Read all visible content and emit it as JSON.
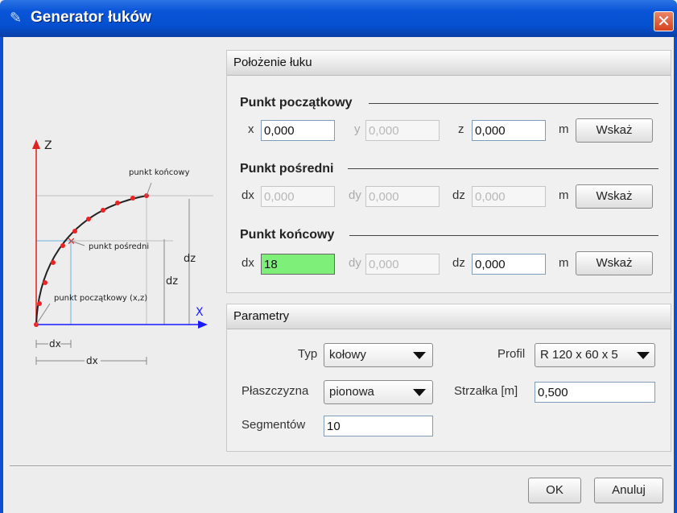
{
  "window": {
    "title": "Generator łuków"
  },
  "diagram": {
    "axis_z": "Z",
    "axis_x": "X",
    "label_end": "punkt końcowy",
    "label_mid": "punkt pośredni",
    "label_start": "punkt początkowy (x,z)",
    "label_dz1": "dz",
    "label_dz2": "dz",
    "label_dx1": "dx",
    "label_dx2": "dx",
    "colors": {
      "axis": "#1a1aff",
      "zaxis": "#dd2222",
      "curve": "#222222",
      "points": "#ee2222",
      "guide": "#6fb3e0"
    }
  },
  "position_group": {
    "header": "Położenie łuku",
    "start": {
      "title": "Punkt początkowy",
      "x_label": "x",
      "x_value": "0,000",
      "y_label": "y",
      "y_value": "0,000",
      "z_label": "z",
      "z_value": "0,000",
      "unit": "m",
      "button": "Wskaż"
    },
    "mid": {
      "title": "Punkt pośredni",
      "dx_label": "dx",
      "dx_value": "0,000",
      "dy_label": "dy",
      "dy_value": "0,000",
      "dz_label": "dz",
      "dz_value": "0,000",
      "unit": "m",
      "button": "Wskaż"
    },
    "end": {
      "title": "Punkt końcowy",
      "dx_label": "dx",
      "dx_value": "18",
      "dy_label": "dy",
      "dy_value": "0,000",
      "dz_label": "dz",
      "dz_value": "0,000",
      "unit": "m",
      "button": "Wskaż"
    }
  },
  "params_group": {
    "header": "Parametry",
    "typ_label": "Typ",
    "typ_value": "kołowy",
    "profil_label": "Profil",
    "profil_value": "R 120 x 60 x 5",
    "plaszczyzna_label": "Płaszczyzna",
    "plaszczyzna_value": "pionowa",
    "strzalka_label": "Strzałka [m]",
    "strzalka_value": "0,500",
    "segmentow_label": "Segmentów",
    "segmentow_value": "10"
  },
  "footer": {
    "ok": "OK",
    "cancel": "Anuluj"
  }
}
